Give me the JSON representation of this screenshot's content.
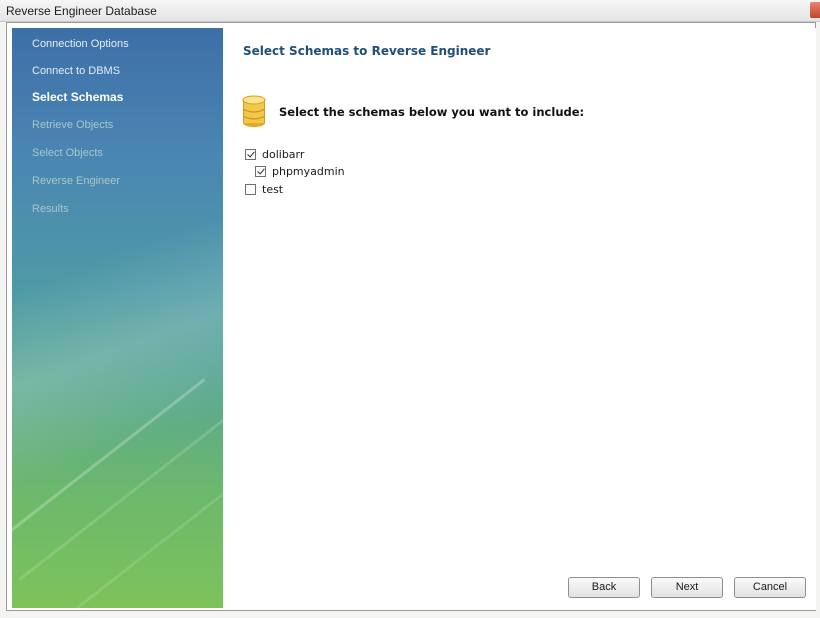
{
  "window": {
    "title": "Reverse Engineer Database"
  },
  "sidebar": {
    "steps": [
      {
        "label": "Connection Options",
        "state": "done"
      },
      {
        "label": "Connect to DBMS",
        "state": "done"
      },
      {
        "label": "Select Schemas",
        "state": "current"
      },
      {
        "label": "Retrieve Objects",
        "state": "pending"
      },
      {
        "label": "Select Objects",
        "state": "pending"
      },
      {
        "label": "Reverse Engineer",
        "state": "pending"
      },
      {
        "label": "Results",
        "state": "pending"
      }
    ]
  },
  "main": {
    "heading": "Select Schemas to Reverse Engineer",
    "icon": "database-icon",
    "instruction": "Select the schemas below you want to include:",
    "schemas": [
      {
        "name": "dolibarr",
        "checked": true
      },
      {
        "name": "phpmyadmin",
        "checked": true
      },
      {
        "name": "test",
        "checked": false
      }
    ]
  },
  "buttons": {
    "back": "Back",
    "next": "Next",
    "cancel": "Cancel"
  },
  "colors": {
    "heading": "#1f4e7a",
    "sidebar_top": "#3d6fa7",
    "sidebar_bottom": "#7dc35a"
  }
}
